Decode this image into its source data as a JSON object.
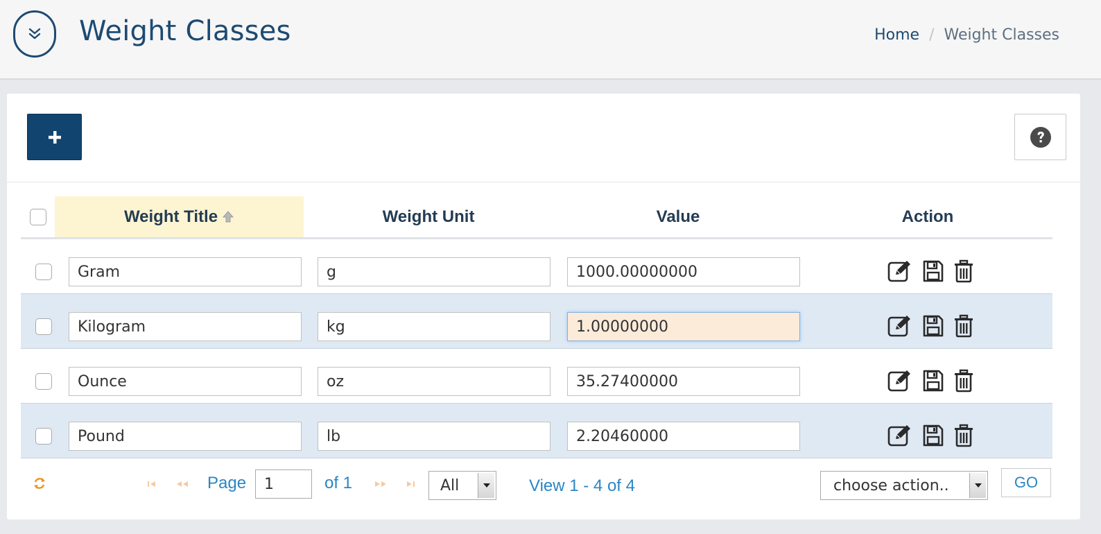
{
  "header": {
    "title": "Weight Classes",
    "breadcrumb": {
      "home": "Home",
      "separator": "/",
      "current": "Weight Classes"
    }
  },
  "toolbar": {
    "add_label": "+"
  },
  "grid": {
    "columns": [
      "Weight Title",
      "Weight Unit",
      "Value",
      "Action"
    ],
    "sorted_column": "Weight Title",
    "sort_direction": "ascending",
    "rows": [
      {
        "title": "Gram",
        "unit": "g",
        "value": "1000.00000000"
      },
      {
        "title": "Kilogram",
        "unit": "kg",
        "value": "1.00000000"
      },
      {
        "title": "Ounce",
        "unit": "oz",
        "value": "35.27400000"
      },
      {
        "title": "Pound",
        "unit": "lb",
        "value": "2.20460000"
      }
    ],
    "focused_row": 1,
    "row_actions": [
      "edit-icon",
      "save-icon",
      "trash-icon"
    ]
  },
  "pager": {
    "page_label": "Page",
    "page_value": "1",
    "of_label": "of 1",
    "rows_per_page": "All",
    "view_label": "View 1 - 4 of 4",
    "bulk_action_placeholder": "choose action..",
    "go_label": "GO"
  },
  "colors": {
    "brand": "#124470",
    "title": "#1d4a72",
    "link": "#2a86c5",
    "sorted_header_bg": "#fdf5d2",
    "alt_row_bg": "#dfe9f4",
    "focused_input_bg": "#fcebd9"
  }
}
